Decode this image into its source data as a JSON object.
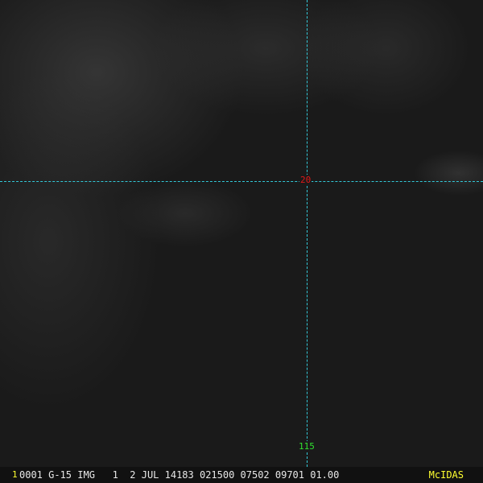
{
  "overlay": {
    "latitude_label": "20",
    "longitude_label": "115",
    "line_color": "#33c8d8",
    "lat_color": "#e01818",
    "lon_color": "#30e030"
  },
  "status_bar": {
    "frame_number": "1",
    "info": "0001 G-15 IMG   1  2 JUL 14183 021500 07502 09701 01.00",
    "logo": "McIDAS"
  }
}
